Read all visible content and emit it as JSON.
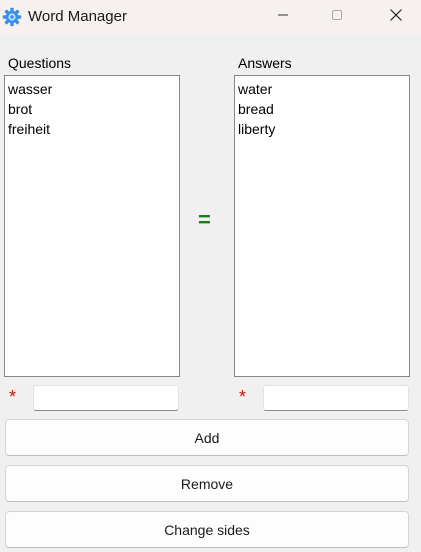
{
  "window": {
    "title": "Word Manager",
    "icon": "gear-icon",
    "controls": [
      "minimize-icon",
      "maximize-icon",
      "close-icon"
    ]
  },
  "questions": {
    "label": "Questions",
    "items": [
      "wasser",
      "brot",
      "freiheit"
    ],
    "input_value": ""
  },
  "answers": {
    "label": "Answers",
    "items": [
      "water",
      "bread",
      "liberty"
    ],
    "input_value": ""
  },
  "separator": "=",
  "required_marker": "*",
  "buttons": {
    "add": "Add",
    "remove": "Remove",
    "change_sides": "Change sides"
  },
  "colors": {
    "equals": "#1b7a1b",
    "required": "#d01010",
    "titlebar": "#f6f0ee",
    "background": "#f0f0f0"
  }
}
